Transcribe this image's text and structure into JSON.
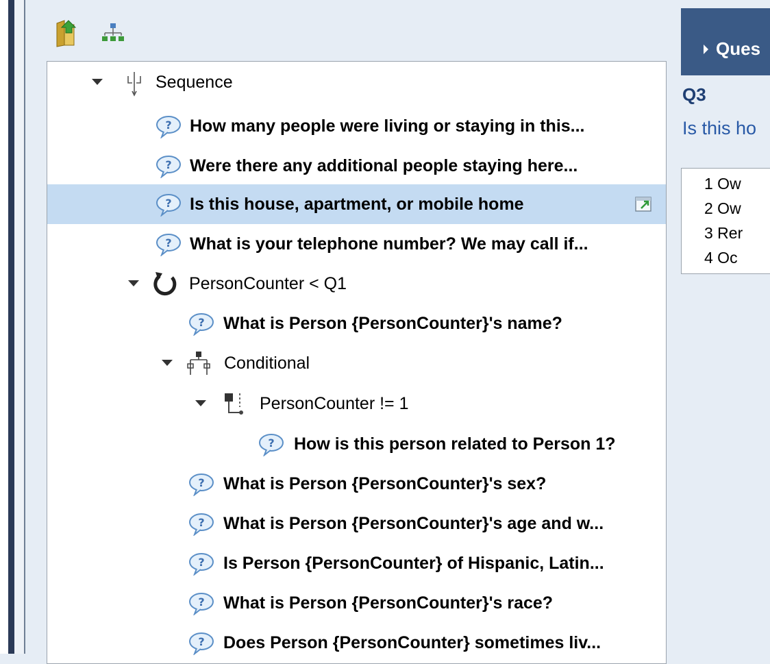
{
  "toolbar": {
    "icons": [
      "open-folder-icon",
      "hierarchy-icon"
    ]
  },
  "tree": {
    "rows": [
      {
        "label": "Sequence",
        "icon": "sequence-icon",
        "style": "plain",
        "expander": true
      },
      {
        "label": "How many people were living or staying in this...",
        "icon": "question-icon",
        "style": "bold"
      },
      {
        "label": "Were there any additional people staying here...",
        "icon": "question-icon",
        "style": "bold"
      },
      {
        "label": "Is this house, apartment, or mobile home",
        "icon": "question-icon",
        "style": "bold",
        "selected": true
      },
      {
        "label": "What is your telephone number? We may call if...",
        "icon": "question-icon",
        "style": "bold"
      },
      {
        "label": "PersonCounter < Q1",
        "icon": "loop-icon",
        "style": "plain",
        "expander": true
      },
      {
        "label": "What is Person {PersonCounter}'s name?",
        "icon": "question-icon",
        "style": "bold"
      },
      {
        "label": "Conditional",
        "icon": "conditional-icon",
        "style": "plain",
        "expander": true
      },
      {
        "label": "PersonCounter != 1",
        "icon": "branch-icon",
        "style": "plain",
        "expander": true
      },
      {
        "label": "How is this person related to Person 1?",
        "icon": "question-icon",
        "style": "bold"
      },
      {
        "label": "What is Person {PersonCounter}'s sex?",
        "icon": "question-icon",
        "style": "bold"
      },
      {
        "label": "What is Person {PersonCounter}'s age and w...",
        "icon": "question-icon",
        "style": "bold"
      },
      {
        "label": "Is Person {PersonCounter} of Hispanic, Latin...",
        "icon": "question-icon",
        "style": "bold"
      },
      {
        "label": "What is Person {PersonCounter}'s race?",
        "icon": "question-icon",
        "style": "bold"
      },
      {
        "label": "Does Person {PersonCounter} sometimes liv...",
        "icon": "question-icon",
        "style": "bold"
      }
    ]
  },
  "detail": {
    "header_title": "Ques",
    "question_id": "Q3",
    "question_text": "Is this ho",
    "options": [
      "1 Ow",
      "2 Ow",
      "3 Rer",
      "4 Oc"
    ]
  },
  "colors": {
    "selection": "#c4dbf2",
    "header": "#3a5a86",
    "question_id": "#1f3f73",
    "question_text": "#2859a6"
  }
}
